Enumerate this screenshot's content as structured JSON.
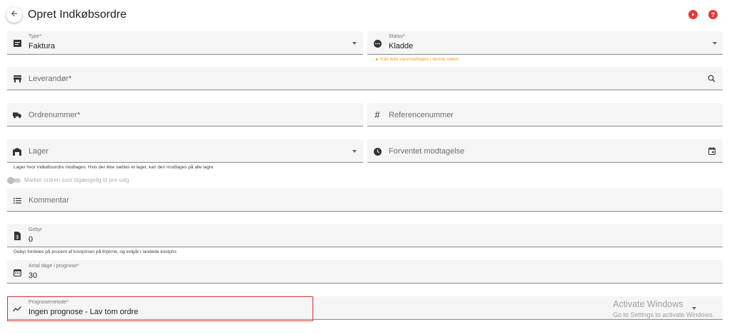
{
  "header": {
    "title": "Opret Indkøbsordre",
    "back_icon": "arrow-left-icon",
    "play_icon": "play-circle-icon",
    "help_icon": "help-circle-icon",
    "accent_color": "#e53935"
  },
  "form": {
    "type": {
      "label": "Type*",
      "value": "Faktura",
      "icon": "receipt-icon"
    },
    "status": {
      "label": "Status*",
      "value": "Kladde",
      "icon": "more-circle-icon",
      "warning": "Kan ikke varemodtages i denne status",
      "warning_glyph": "▲"
    },
    "supplier": {
      "placeholder": "Leverandør*",
      "icon": "store-icon",
      "trailing_icon": "search-icon"
    },
    "order_number": {
      "placeholder": "Ordrenummer*",
      "icon": "truck-icon"
    },
    "reference_number": {
      "placeholder": "Referencenummer",
      "icon": "hash-icon",
      "glyph": "#"
    },
    "warehouse": {
      "placeholder": "Lager",
      "icon": "warehouse-icon",
      "helper": "Lager hvor indkøbsordre modtages. Hvis der ikke sættes et lager, kan den modtages på alle lagre"
    },
    "expected_receipt": {
      "placeholder": "Forventet modtagelse",
      "icon": "clock-icon",
      "trailing_icon": "calendar-icon"
    },
    "presale_toggle": {
      "label": "Marker ordren som tilgængelig til pre-salg",
      "checked": false
    },
    "comment": {
      "placeholder": "Kommentar",
      "icon": "list-icon"
    },
    "fee": {
      "label": "Gebyr",
      "value": "0",
      "icon": "money-doc-icon",
      "helper": "Gebyr fordeles på procent af kostprisen på linjerne, og indgår i landede kostpris"
    },
    "forecast_days": {
      "label": "Antal dage i prognose*",
      "value": "30",
      "icon": "calendar-range-icon"
    },
    "forecast_method": {
      "label": "Prognosemetode*",
      "value": "Ingen prognose - Lav tom ordre",
      "icon": "trending-icon"
    }
  },
  "watermark": {
    "title": "Activate Windows",
    "subtitle": "Go to Settings to activate Windows."
  }
}
